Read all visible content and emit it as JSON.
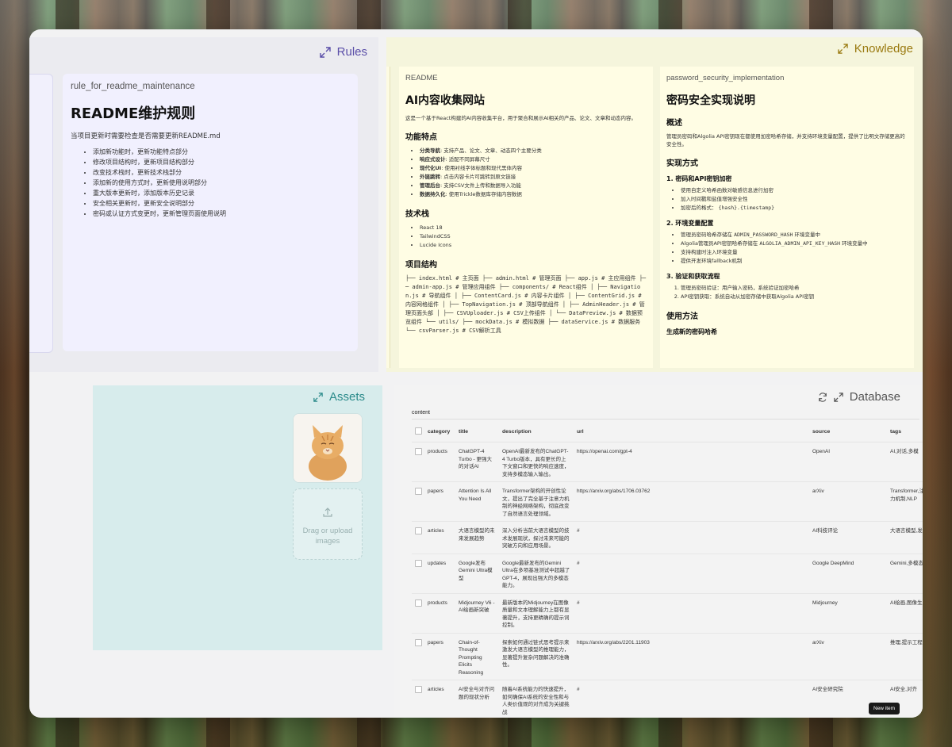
{
  "rules": {
    "title": "Rules",
    "card": {
      "tag": "rule_for_readme_maintenance",
      "heading": "README维护规则",
      "intro": "当项目更新时需要检查是否需要更新README.md",
      "items": [
        "添加新功能时，更新功能特点部分",
        "修改项目结构时，更新项目结构部分",
        "改变技术栈时，更新技术栈部分",
        "添加新的使用方式时，更新使用说明部分",
        "重大版本更新时，添加版本历史记录",
        "安全相关更新时，更新安全说明部分",
        "密码或认证方式变更时，更新管理页面使用说明"
      ]
    }
  },
  "knowledge": {
    "title": "Knowledge",
    "readme": {
      "tag": "README",
      "heading": "AI内容收集网站",
      "intro": "这是一个基于React构建的AI内容收集平台，用于聚合和展示AI相关的产品、论文、文章和动态内容。",
      "features_heading": "功能特点",
      "features": [
        {
          "label": "分类导航",
          "text": ": 支持产品、论文、文章、动态四个主要分类"
        },
        {
          "label": "响应式设计",
          "text": ": 适配不同屏幕尺寸"
        },
        {
          "label": "现代化UI",
          "text": ": 使用衬线字体标题和现代黑体内容"
        },
        {
          "label": "外链跳转",
          "text": ": 点击内容卡片可跳转到原文链接"
        },
        {
          "label": "管理后台",
          "text": ": 支持CSV文件上传和数据导入功能"
        },
        {
          "label": "数据持久化",
          "text": ": 使用Trickle数据库存储内容数据"
        }
      ],
      "tech_heading": "技术栈",
      "tech": [
        "React 18",
        "TailwindCSS",
        "Lucide Icons"
      ],
      "structure_heading": "项目结构",
      "structure": "├── index.html # 主页面 ├── admin.html # 管理页面 ├── app.js # 主应用组件 ├── admin-app.js # 管理应用组件 ├── components/ # React组件 │ ├── Navigation.js # 导航组件 │ ├── ContentCard.js # 内容卡片组件 │ ├── ContentGrid.js # 内容网格组件 │ ├── TopNavigation.js # 顶部导航组件 │ ├── AdminHeader.js # 管理页面头部 │ ├── CSVUploader.js # CSV上传组件 │ └── DataPreview.js # 数据预览组件 └── utils/ ├── mockData.js # 模拟数据 ├── dataService.js # 数据服务 └── csvParser.js # CSV解析工具"
    },
    "password": {
      "tag": "password_security_implementation",
      "heading": "密码安全实现说明",
      "overview_heading": "概述",
      "overview": "管理员密码和Algolia API密钥现在都使用加密哈希存储，并支持环境变量配置，提供了比明文存储更高的安全性。",
      "impl_heading": "实现方式",
      "s1_heading": "1. 密码和API密钥加密",
      "s1_items": [
        "使用自定义哈希函数对敏感信息进行加密",
        "加入时间戳和盐值增强安全性"
      ],
      "s1_format_label": "加密后的格式：",
      "s1_format_code": "{hash}.{timestamp}",
      "s2_heading": "2. 环境变量配置",
      "s2_item1_label": "管理员密码哈希存储在",
      "s2_item1_code": "ADMIN_PASSWORD_HASH",
      "s2_item1_tail": "环境变量中",
      "s2_item2_label": "Algolia管理员API密钥哈希存储在",
      "s2_item2_code": "ALGOLIA_ADMIN_API_KEY_HASH",
      "s2_item2_tail": "环境变量中",
      "s2_items_rest": [
        "支持构建时注入环境变量",
        "提供开发环境fallback机制"
      ],
      "s3_heading": "3. 验证和获取流程",
      "s3_items": [
        "管理员密码验证：用户输入密码，系统验证加密哈希",
        "API密钥获取：系统自动从加密存储中获取Algolia API密钥"
      ],
      "usage_heading": "使用方法",
      "gen_heading": "生成新的密码哈希"
    }
  },
  "assets": {
    "title": "Assets",
    "upload_text": "Drag or upload images"
  },
  "database": {
    "title": "Database",
    "tab": "content",
    "columns": [
      "category",
      "title",
      "description",
      "url",
      "source",
      "tags"
    ],
    "rows": [
      {
        "category": "products",
        "title": "ChatGPT-4 Turbo - 更强大的对话AI",
        "description": "OpenAI最新发布的ChatGPT-4 Turbo版本，具有更长的上下文窗口和更快的响应速度，支持多模态输入输出。",
        "url": "https://openai.com/gpt-4",
        "source": "OpenAI",
        "tags": "AI,对话,多模"
      },
      {
        "category": "papers",
        "title": "Attention Is All You Need",
        "description": "Transformer架构的开创性论文，提出了完全基于注意力机制的神经网络架构，彻底改变了自然语言处理领域。",
        "url": "https://arxiv.org/abs/1706.03762",
        "source": "arXiv",
        "tags": "Transformer,注意力机制,NLP"
      },
      {
        "category": "articles",
        "title": "大语言模型的未来发展趋势",
        "description": "深入分析当前大语言模型的技术发展现状，探讨未来可能的突破方向和应用场景。",
        "url": "#",
        "source": "AI科技评论",
        "tags": "大语言模型,发展"
      },
      {
        "category": "updates",
        "title": "Google发布Gemini Ultra模型",
        "description": "Google最新发布的Gemini Ultra在多项基准测试中超越了GPT-4，展现出强大的多模态能力。",
        "url": "#",
        "source": "Google DeepMind",
        "tags": "Gemini,多模态"
      },
      {
        "category": "products",
        "title": "Midjourney V6 - AI绘画新突破",
        "description": "最新版本的Midjourney在图像质量和文本理解能力上都有显著提升，支持更精确的提示词控制。",
        "url": "#",
        "source": "Midjourney",
        "tags": "AI绘画,图像生成"
      },
      {
        "category": "papers",
        "title": "Chain-of-Thought Prompting Elicits Reasoning",
        "description": "探索如何通过链式思考提示来激发大语言模型的推理能力，显著提升复杂问题解决的准确性。",
        "url": "https://arxiv.org/abs/2201.11903",
        "source": "arXiv",
        "tags": "推理,提示工程"
      },
      {
        "category": "articles",
        "title": "AI安全与对齐问题的现状分析",
        "description": "随着AI系统能力的快速提升，如何确保AI系统的安全性和与人类价值观的对齐成为关键挑战",
        "url": "#",
        "source": "AI安全研究院",
        "tags": "AI安全,对齐"
      }
    ],
    "new_item_label": "New item"
  }
}
